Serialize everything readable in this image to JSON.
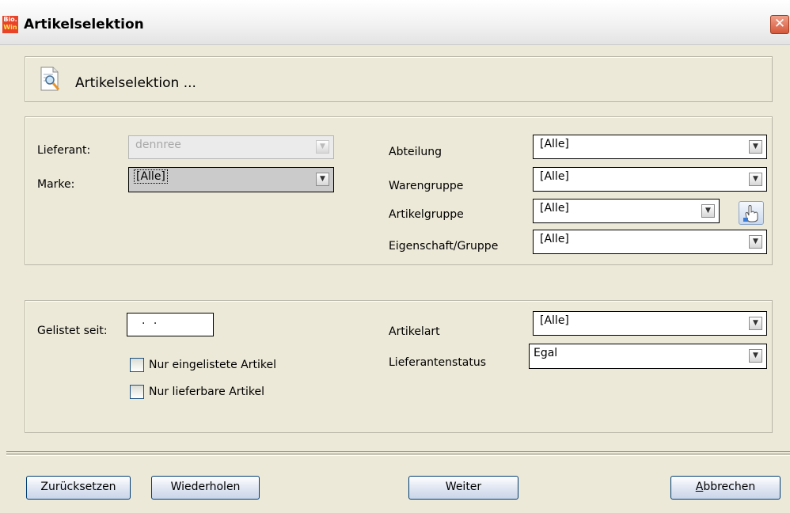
{
  "window": {
    "title": "Artikelselektion",
    "app_icon_top": "Bio.",
    "app_icon_bottom": "Win",
    "close_glyph": "✕"
  },
  "header": {
    "text": "Artikelselektion ...",
    "icon": "document-magnifier-icon"
  },
  "filters": {
    "lieferant": {
      "label": "Lieferant:",
      "value": "dennree"
    },
    "marke": {
      "label": "Marke:",
      "value": "[Alle]"
    },
    "abteilung": {
      "label": "Abteilung",
      "value": "[Alle]"
    },
    "warengruppe": {
      "label": "Warengruppe",
      "value": "[Alle]"
    },
    "artikelgruppe": {
      "label": "Artikelgruppe",
      "value": "[Alle]"
    },
    "eigenschaft": {
      "label": "Eigenschaft/Gruppe",
      "value": "[Alle]"
    }
  },
  "options": {
    "gelistet": {
      "label": "Gelistet seit:",
      "value": ". ."
    },
    "nur_eingelistete": {
      "label": "Nur eingelistete Artikel",
      "checked": false
    },
    "nur_lieferbare": {
      "label": "Nur lieferbare Artikel",
      "checked": false
    },
    "artikelart": {
      "label": "Artikelart",
      "value": "[Alle]"
    },
    "lieferantenstatus": {
      "label": "Lieferantenstatus",
      "value": "Egal"
    }
  },
  "buttons": {
    "reset": "Zurücksetzen",
    "repeat": "Wiederholen",
    "next": "Weiter",
    "cancel_prefix": "A",
    "cancel_rest": "bbrechen"
  },
  "dropdown_glyph": "▼",
  "colors": {
    "titlebar": "#f2f2f2",
    "dialog_bg": "#ece9d8",
    "close_button": "#d5573a",
    "button_border": "#003c74"
  }
}
